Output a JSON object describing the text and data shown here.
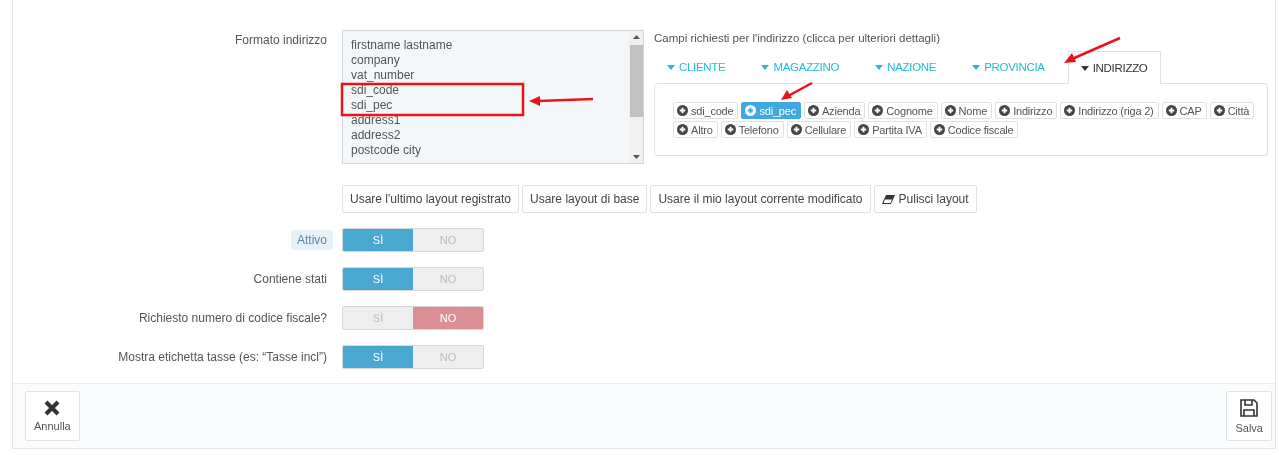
{
  "address_format": {
    "label": "Formato indirizzo",
    "lines": [
      "firstname lastname",
      "company",
      "vat_number",
      "sdi_code",
      "sdi_pec",
      "address1",
      "address2",
      "postcode city"
    ]
  },
  "required_fields": {
    "title": "Campi richiesti per l'indirizzo (clicca per ulteriori dettagli)",
    "tabs": [
      {
        "label": "CLIENTE",
        "selected": false
      },
      {
        "label": "MAGAZZINO",
        "selected": false
      },
      {
        "label": "NAZIONE",
        "selected": false
      },
      {
        "label": "PROVINCIA",
        "selected": false
      },
      {
        "label": "INDIRIZZO",
        "selected": true
      }
    ],
    "fields": [
      {
        "label": "sdi_code",
        "selected": false
      },
      {
        "label": "sdi_pec",
        "selected": true
      },
      {
        "label": "Azienda",
        "selected": false
      },
      {
        "label": "Cognome",
        "selected": false
      },
      {
        "label": "Nome",
        "selected": false
      },
      {
        "label": "Indirizzo",
        "selected": false
      },
      {
        "label": "Indirizzo (riga 2)",
        "selected": false
      },
      {
        "label": "CAP",
        "selected": false
      },
      {
        "label": "Città",
        "selected": false
      },
      {
        "label": "Altro",
        "selected": false
      },
      {
        "label": "Telefono",
        "selected": false
      },
      {
        "label": "Cellulare",
        "selected": false
      },
      {
        "label": "Partita IVA",
        "selected": false
      },
      {
        "label": "Codice fiscale",
        "selected": false
      }
    ]
  },
  "layout_buttons": [
    {
      "label": "Usare l'ultimo layout registrato",
      "kind": "text"
    },
    {
      "label": "Usare layout di base",
      "kind": "text"
    },
    {
      "label": "Usare il mio layout corrente modificato",
      "kind": "text"
    },
    {
      "label": "Pulisci layout",
      "kind": "eraser"
    }
  ],
  "toggles": [
    {
      "label": "Attivo",
      "highlighted": true,
      "on": true,
      "yes": "SÌ",
      "no": "NO"
    },
    {
      "label": "Contiene stati",
      "highlighted": false,
      "on": true,
      "yes": "SÌ",
      "no": "NO"
    },
    {
      "label": "Richiesto numero di codice fiscale?",
      "highlighted": false,
      "on": false,
      "yes": "SÌ",
      "no": "NO"
    },
    {
      "label": "Mostra etichetta tasse (es: “Tasse incl”)",
      "highlighted": false,
      "on": true,
      "yes": "SÌ",
      "no": "NO"
    }
  ],
  "footer": {
    "cancel": "Annulla",
    "save": "Salva"
  }
}
